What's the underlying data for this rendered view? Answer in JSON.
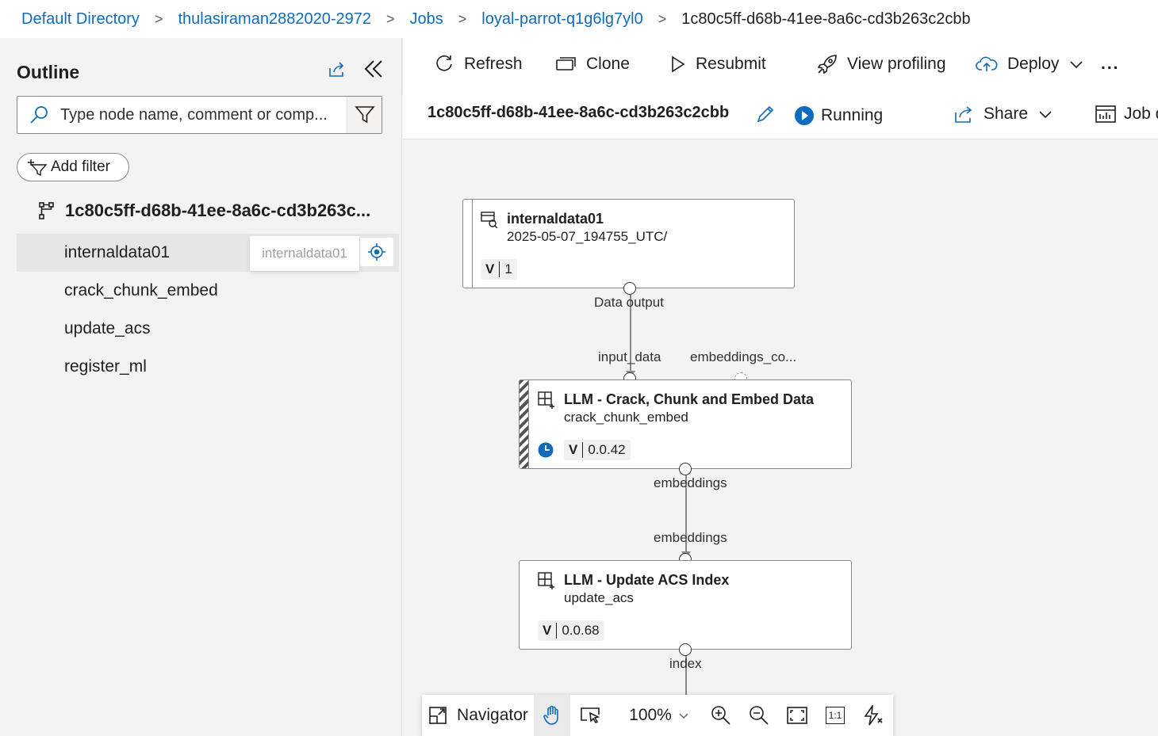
{
  "breadcrumb": {
    "items": [
      "Default Directory",
      "thulasiraman2882020-2972",
      "Jobs",
      "loyal-parrot-q1g6lg7yl0"
    ],
    "current": "1c80c5ff-d68b-41ee-8a6c-cd3b263c2cbb",
    "separator": ">"
  },
  "outline": {
    "title": "Outline",
    "search_placeholder": "Type node name, comment or comp...",
    "add_filter_label": "Add filter",
    "root_label": "1c80c5ff-d68b-41ee-8a6c-cd3b263c...",
    "items": [
      {
        "label": "internaldata01",
        "selected": true
      },
      {
        "label": "crack_chunk_embed",
        "selected": false
      },
      {
        "label": "update_acs",
        "selected": false
      },
      {
        "label": "register_ml",
        "selected": false
      }
    ],
    "tooltip": "internaldata01"
  },
  "toolbar": {
    "refresh": "Refresh",
    "clone": "Clone",
    "resubmit": "Resubmit",
    "view_profiling": "View profiling",
    "deploy": "Deploy",
    "more": "..."
  },
  "job": {
    "id": "1c80c5ff-d68b-41ee-8a6c-cd3b263c2cbb",
    "status": "Running",
    "share": "Share",
    "job_tab": "Job d"
  },
  "graph": {
    "nodes": [
      {
        "title": "internaldata01",
        "subtitle": "2025-05-07_194755_UTC/",
        "version_tag": "V",
        "version": "1"
      },
      {
        "title": "LLM - Crack, Chunk and Embed Data",
        "subtitle": "crack_chunk_embed",
        "version_tag": "V",
        "version": "0.0.42"
      },
      {
        "title": "LLM - Update ACS Index",
        "subtitle": "update_acs",
        "version_tag": "V",
        "version": "0.0.68"
      }
    ],
    "port_labels": {
      "data_output": "Data output",
      "input_data": "input_data",
      "embeddings_co": "embeddings_co...",
      "embeddings_out": "embeddings",
      "embeddings_in": "embeddings",
      "index": "index"
    }
  },
  "navigator": {
    "label": "Navigator",
    "zoom": "100%",
    "actual_size": "1:1"
  },
  "colors": {
    "accent": "#0f6cbd",
    "running": "#0f6cbd",
    "panel_bg": "#f3f3f3"
  }
}
